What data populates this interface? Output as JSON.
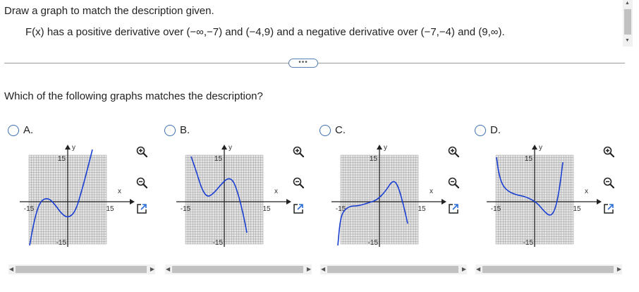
{
  "question": {
    "title": "Draw a graph to match the description given.",
    "description": "F(x) has a positive derivative over (−∞,−7) and (−4,9) and a negative derivative over (−7,−4) and (9,∞).",
    "more_label": "•••",
    "prompt": "Which of the following graphs matches the description?"
  },
  "options": [
    {
      "letter": "A.",
      "selected": false,
      "shape": "A"
    },
    {
      "letter": "B.",
      "selected": false,
      "shape": "B"
    },
    {
      "letter": "C.",
      "selected": false,
      "shape": "C"
    },
    {
      "letter": "D.",
      "selected": false,
      "shape": "D"
    }
  ],
  "axis": {
    "x_label": "x",
    "y_label": "y",
    "tick_pos": "15",
    "tick_neg": "-15",
    "range": [
      -15,
      15
    ]
  },
  "icons": {
    "zoom_in": "zoom-in-icon",
    "zoom_out": "zoom-out-icon",
    "expand": "expand-icon"
  },
  "colors": {
    "curve": "#1a3fd1",
    "accent": "#3b6fb6",
    "grid": "#9a9a9a"
  }
}
